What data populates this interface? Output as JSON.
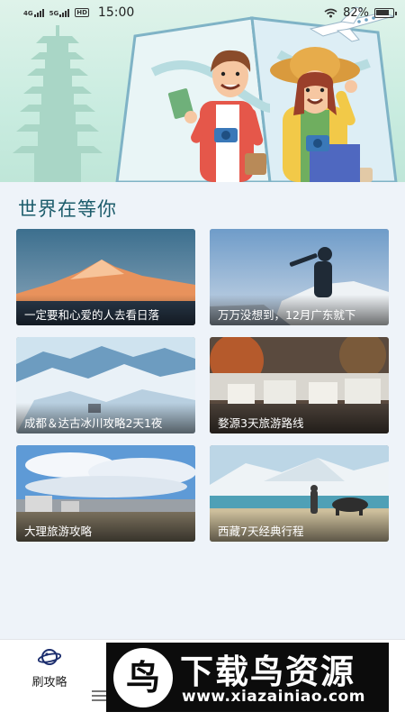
{
  "status_bar": {
    "network_left": "4G",
    "network_right": "5G",
    "hd_badge": "HD",
    "time": "15:00",
    "battery": "82%",
    "battery_fraction": 0.82
  },
  "section": {
    "title": "世界在等你"
  },
  "cards": [
    {
      "caption": "一定要和心爱的人去看日落"
    },
    {
      "caption": "万万没想到，12月广东就下"
    },
    {
      "caption": "成都＆达古冰川攻略2天1夜"
    },
    {
      "caption": "婺源3天旅游路线"
    },
    {
      "caption": "大理旅游攻略"
    },
    {
      "caption": "西藏7天经典行程"
    }
  ],
  "tabbar": {
    "tab_label": "刷攻略"
  },
  "watermark": {
    "logo_letter": "鸟",
    "title": "下载鸟资源",
    "url": "www.xiazainiao.com"
  }
}
